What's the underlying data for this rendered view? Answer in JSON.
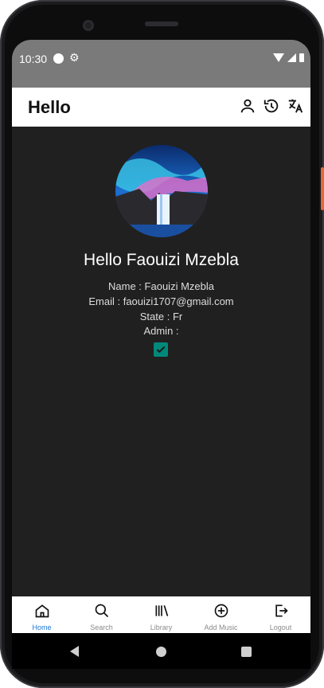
{
  "status_bar": {
    "time": "10:30"
  },
  "app_bar": {
    "title": "Hello"
  },
  "profile": {
    "greeting": "Hello Faouizi Mzebla",
    "name_label": "Name :",
    "name_value": "Faouizi Mzebla",
    "email_label": "Email :",
    "email_value": "faouizi1707@gmail.com",
    "state_label": "State :",
    "state_value": "Fr",
    "admin_label": "Admin :",
    "admin_checked": true
  },
  "bottom_nav": {
    "items": [
      {
        "label": "Home",
        "icon": "home-icon",
        "active": true
      },
      {
        "label": "Search",
        "icon": "search-icon",
        "active": false
      },
      {
        "label": "Library",
        "icon": "library-icon",
        "active": false
      },
      {
        "label": "Add Music",
        "icon": "add-circle-icon",
        "active": false
      },
      {
        "label": "Logout",
        "icon": "logout-icon",
        "active": false
      }
    ]
  },
  "colors": {
    "accent": "#1976d2",
    "checkbox": "#00897b",
    "background": "#202020"
  }
}
